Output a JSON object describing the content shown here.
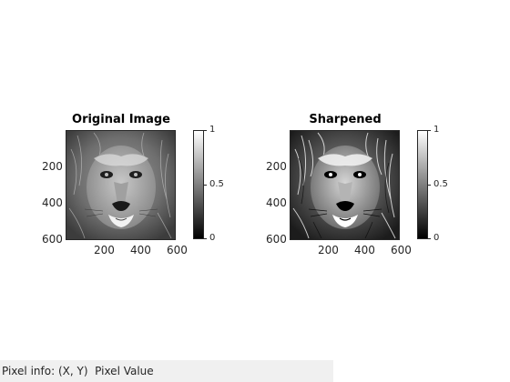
{
  "figure": {
    "background": "#ffffff",
    "panels": [
      {
        "title": "Original Image",
        "image_icon": "lion-face-image",
        "y_ticks": [
          "200",
          "400",
          "600"
        ],
        "x_ticks": [
          "200",
          "400",
          "600"
        ],
        "colorbar_ticks": [
          "1",
          "0.5",
          "0"
        ],
        "colormap": "gray",
        "tone": "smooth"
      },
      {
        "title": "Sharpened",
        "image_icon": "lion-face-image",
        "y_ticks": [
          "200",
          "400",
          "600"
        ],
        "x_ticks": [
          "200",
          "400",
          "600"
        ],
        "colorbar_ticks": [
          "1",
          "0.5",
          "0"
        ],
        "colormap": "gray",
        "tone": "high-contrast"
      }
    ]
  },
  "status_bar": {
    "label": "Pixel info:",
    "coord_label": "(X, Y)",
    "value_label": "Pixel Value",
    "background": "#f0f0f0"
  }
}
